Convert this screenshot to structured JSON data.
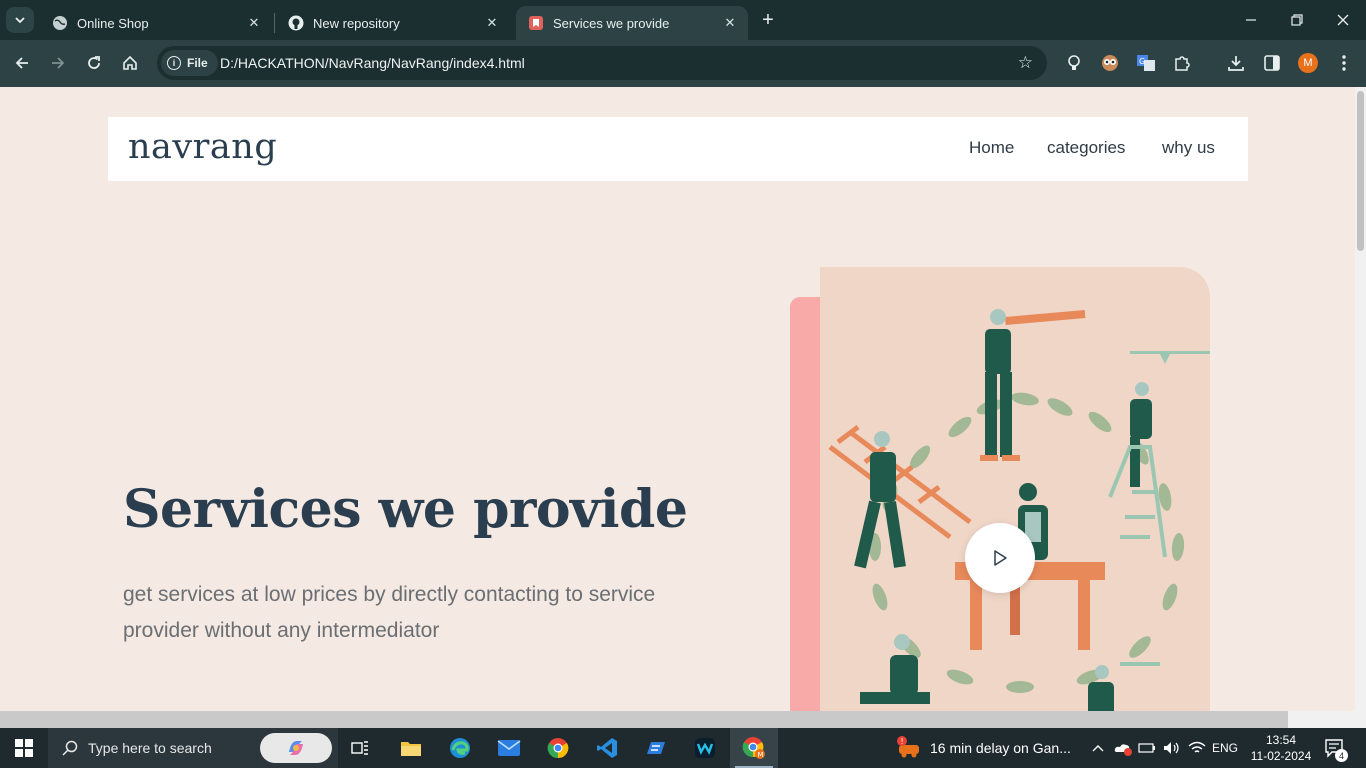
{
  "browser": {
    "tabs": [
      {
        "title": "Online Shop"
      },
      {
        "title": "New repository"
      },
      {
        "title": "Services we provide"
      }
    ],
    "address": {
      "chip": "File",
      "url": "D:/HACKATHON/NavRang/NavRang/index4.html"
    },
    "profile_initial": "M"
  },
  "site": {
    "logo": "navrang",
    "nav": [
      "Home",
      "categories",
      "why us"
    ],
    "hero": {
      "title": "Services we provide",
      "subtitle": "get services at low prices by directly contacting to service provider without any intermediator"
    }
  },
  "taskbar": {
    "search_placeholder": "Type here to search",
    "weather": "16 min delay on Gan...",
    "language": "ENG",
    "time": "13:54",
    "date": "11-02-2024",
    "notifications": "4"
  },
  "colors": {
    "page_bg": "#f4e9e3",
    "heading": "#2b3e4f",
    "accent_pink": "#f8aaa9",
    "art_bg": "#efd6c7",
    "worker_green": "#1f5a4a",
    "wood_orange": "#e8895a"
  }
}
